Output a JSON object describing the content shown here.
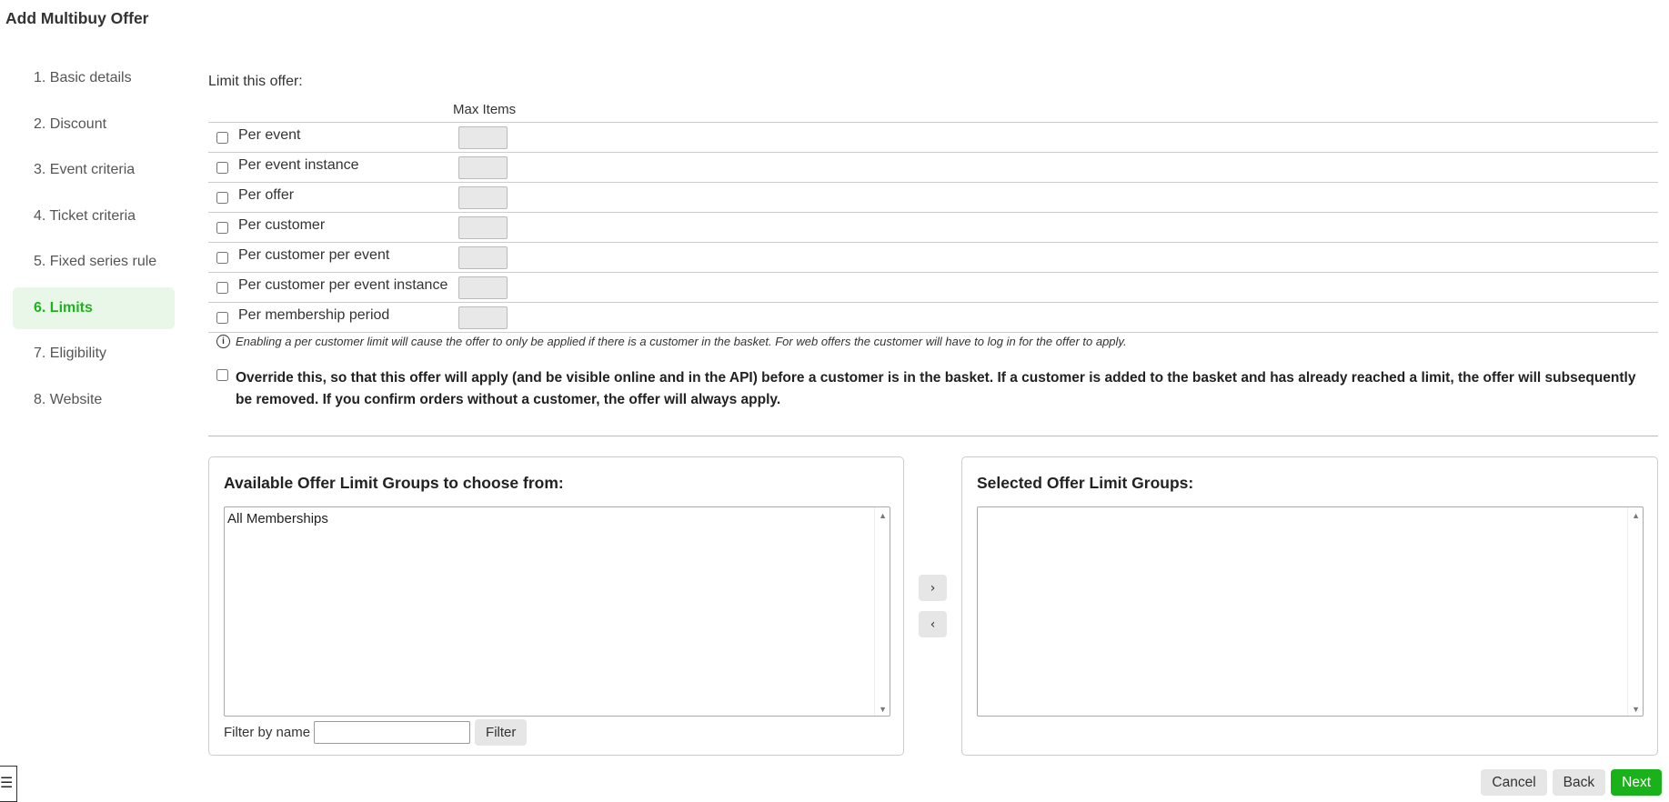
{
  "page": {
    "title": "Add Multibuy Offer"
  },
  "sidebar": {
    "steps": [
      {
        "label": "1. Basic details"
      },
      {
        "label": "2. Discount"
      },
      {
        "label": "3. Event criteria"
      },
      {
        "label": "4. Ticket criteria"
      },
      {
        "label": "5. Fixed series rule"
      },
      {
        "label": "6. Limits",
        "active": true
      },
      {
        "label": "7. Eligibility"
      },
      {
        "label": "8. Website"
      }
    ]
  },
  "limits": {
    "heading": "Limit this offer:",
    "column_header": "Max Items",
    "rows": [
      {
        "label": "Per event",
        "checked": false,
        "value": ""
      },
      {
        "label": "Per event instance",
        "checked": false,
        "value": ""
      },
      {
        "label": "Per offer",
        "checked": false,
        "value": ""
      },
      {
        "label": "Per customer",
        "checked": false,
        "value": ""
      },
      {
        "label": "Per customer per event",
        "checked": false,
        "value": ""
      },
      {
        "label": "Per customer per event instance",
        "checked": false,
        "value": ""
      },
      {
        "label": "Per membership period",
        "checked": false,
        "value": ""
      }
    ],
    "info_text": "Enabling a per customer limit will cause the offer to only be applied if there is a customer in the basket. For web offers the customer will have to log in for the offer to apply.",
    "override_text": "Override this, so that this offer will apply (and be visible online and in the API) before a customer is in the basket. If a customer is added to the basket and has already reached a limit, the offer will subsequently be removed. If you confirm orders without a customer, the offer will always apply."
  },
  "groups": {
    "available_title": "Available Offer Limit Groups to choose from:",
    "available_items": [
      "All Memberships"
    ],
    "selected_title": "Selected Offer Limit Groups:",
    "selected_items": [],
    "filter_label": "Filter by name",
    "filter_value": "",
    "filter_button": "Filter",
    "move_right": "›",
    "move_left": "‹"
  },
  "footer": {
    "cancel": "Cancel",
    "back": "Back",
    "next": "Next"
  },
  "colors": {
    "accent": "#1ab21a",
    "active_bg": "#e9f7e9"
  },
  "icons": {
    "info": "info-icon",
    "menu": "hamburger-icon"
  }
}
